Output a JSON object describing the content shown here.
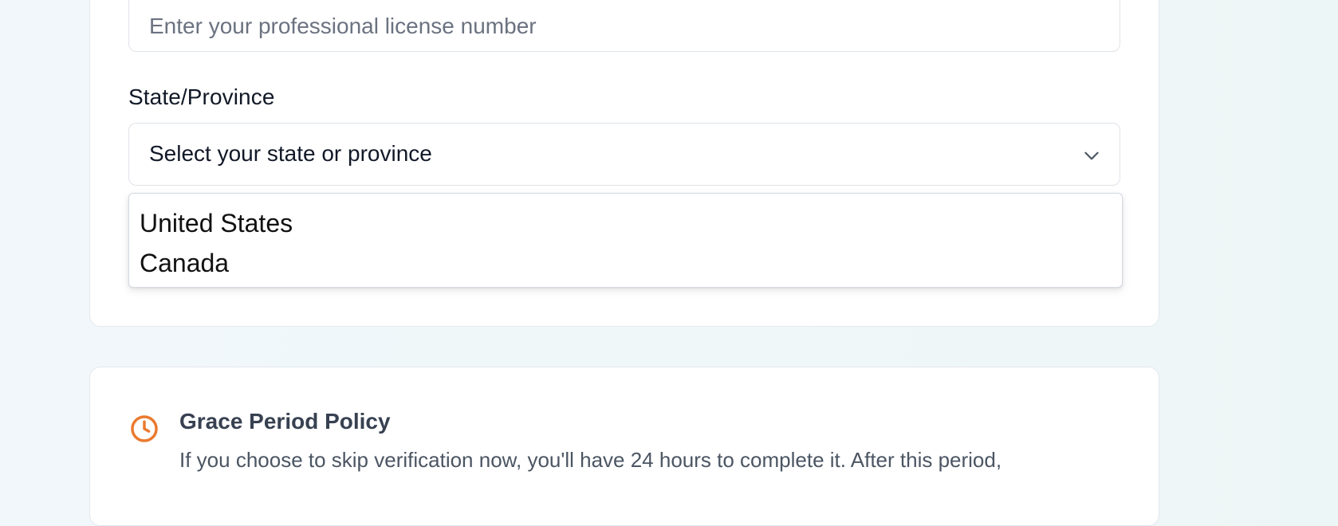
{
  "license": {
    "placeholder": "Enter your professional license number"
  },
  "state_field": {
    "label": "State/Province",
    "selected_text": "Select your state or province",
    "icon": "chevron-down-icon",
    "options": [
      "United States",
      "Canada"
    ]
  },
  "grace_period": {
    "icon": "clock-icon",
    "accent_color": "#ea7a2f",
    "title": "Grace Period Policy",
    "text": "If you choose to skip verification now, you'll have 24 hours to complete it. After this period,"
  }
}
